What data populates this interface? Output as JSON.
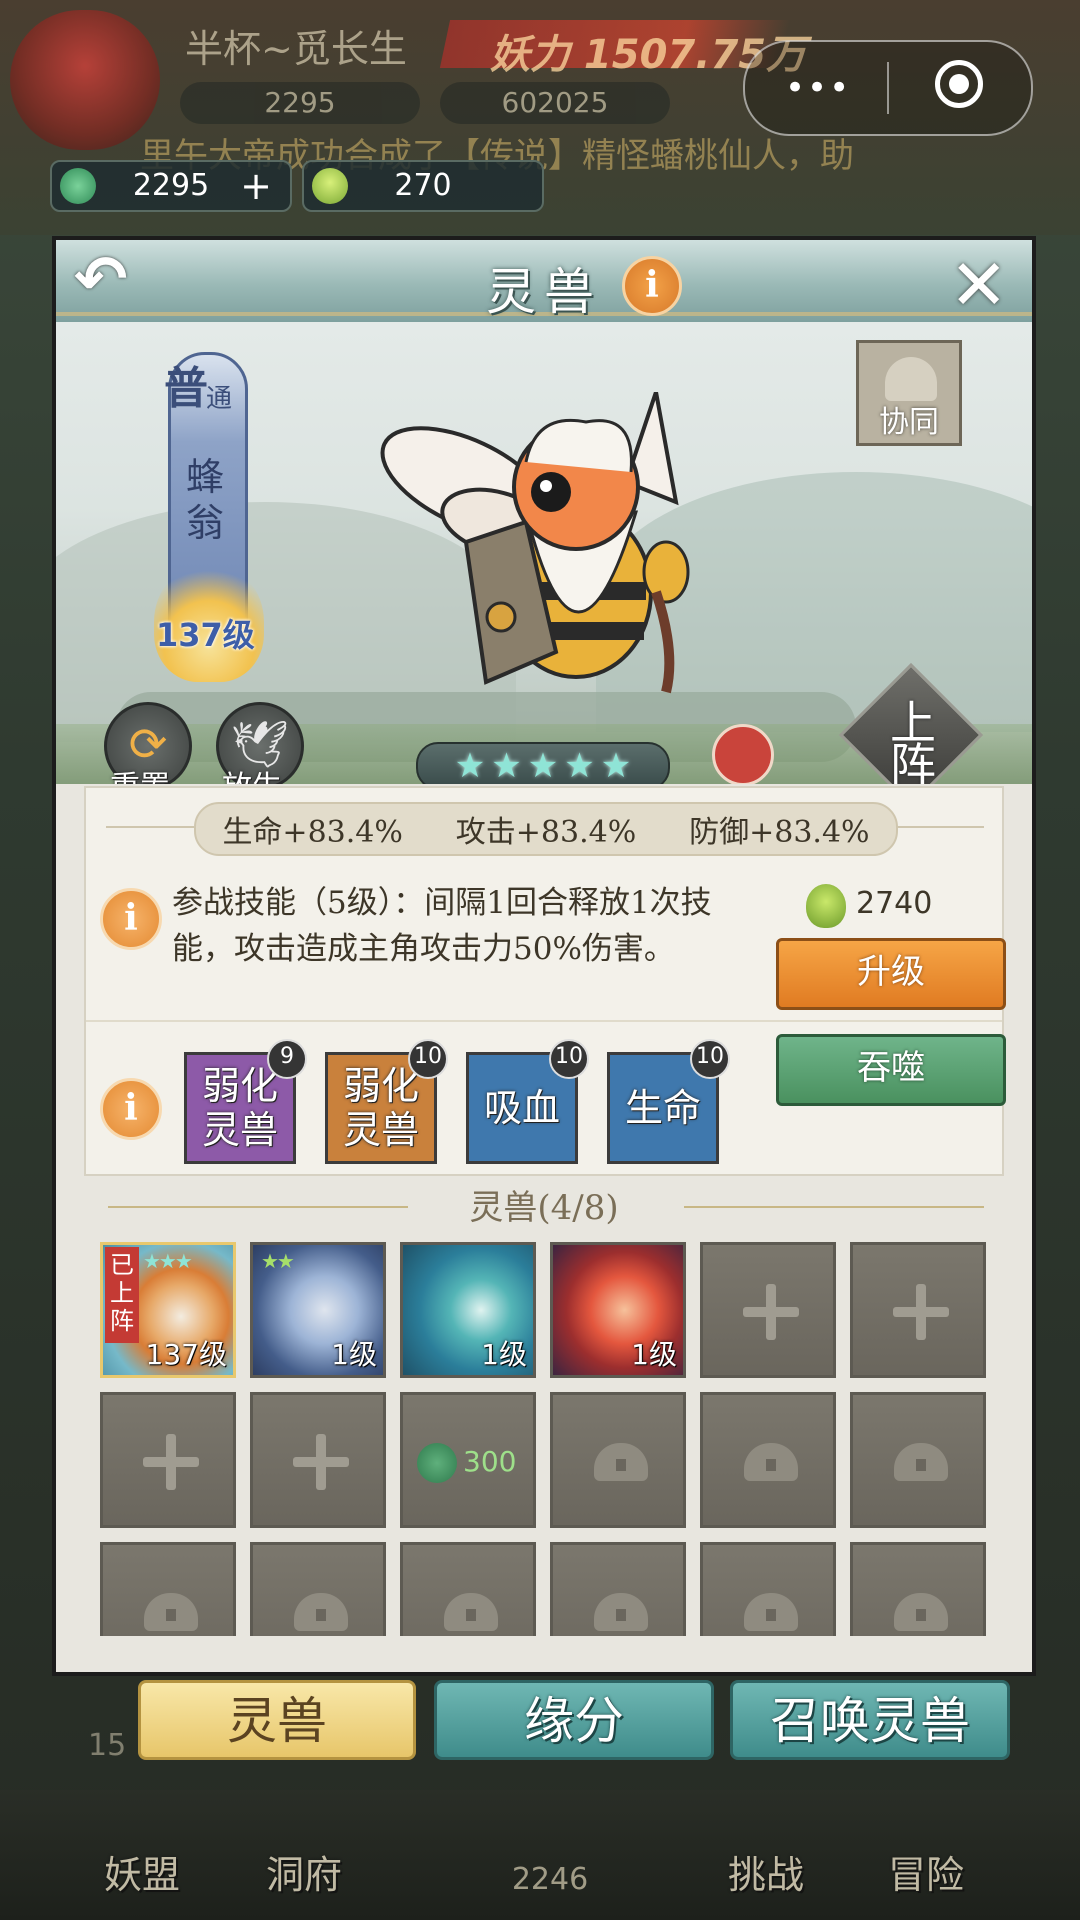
{
  "top_hud": {
    "player_name": "半杯~觅长生",
    "power": "妖力 1507.75万",
    "bg_jade": "2295",
    "bg_crystal": "602025",
    "marquee": "里午大帝成功合成了【传说】精怪蟠桃仙人，助",
    "capsule_dots": "•••"
  },
  "resources": {
    "jade": "2295",
    "jade_plus": "+",
    "gourd": "270"
  },
  "panel": {
    "back": "↶",
    "title": "灵兽",
    "info": "i",
    "close": "✕"
  },
  "beast": {
    "rarity_big": "普",
    "rarity_small": "通",
    "name": "蜂翁",
    "level": "137级",
    "stars": 5,
    "sync_label": "协同",
    "reset_label": "重置",
    "release_label": "放生",
    "deploy_label": "上阵"
  },
  "stats": {
    "hp": "生命+83.4%",
    "atk": "攻击+83.4%",
    "def": "防御+83.4%"
  },
  "skill": {
    "info": "i",
    "text": "参战技能（5级）：间隔1回合释放1次技能，攻击造成主角攻击力50%伤害。",
    "cost": "2740",
    "upgrade_label": "升级",
    "devour_label": "吞噬"
  },
  "traits": [
    {
      "label": "弱化灵兽",
      "level": "9",
      "color": "#8d5aa8"
    },
    {
      "label": "弱化灵兽",
      "level": "10",
      "color": "#c9813c"
    },
    {
      "label": "吸血",
      "level": "10",
      "color": "#3f78ad"
    },
    {
      "label": "生命",
      "level": "10",
      "color": "#3f78ad"
    }
  ],
  "beast_list": {
    "title": "灵兽(4/8)",
    "slots": [
      {
        "type": "beast",
        "level": "137级",
        "deployed": "已上阵",
        "stars": "★★★"
      },
      {
        "type": "beast",
        "level": "1级",
        "stars": "★★"
      },
      {
        "type": "beast",
        "level": "1级",
        "stars": ""
      },
      {
        "type": "beast",
        "level": "1级",
        "stars": ""
      },
      {
        "type": "empty"
      },
      {
        "type": "empty"
      },
      {
        "type": "empty"
      },
      {
        "type": "empty"
      },
      {
        "type": "unlock",
        "cost": "300"
      },
      {
        "type": "locked"
      },
      {
        "type": "locked"
      },
      {
        "type": "locked"
      }
    ]
  },
  "bottom_tabs": {
    "beast": "灵兽",
    "fate": "缘分",
    "summon": "召唤灵兽"
  },
  "bottom_nav": {
    "alliance": "妖盟",
    "cave": "洞府",
    "count": "2246",
    "challenge": "挑战",
    "adventure": "冒险",
    "side_num": "15"
  }
}
